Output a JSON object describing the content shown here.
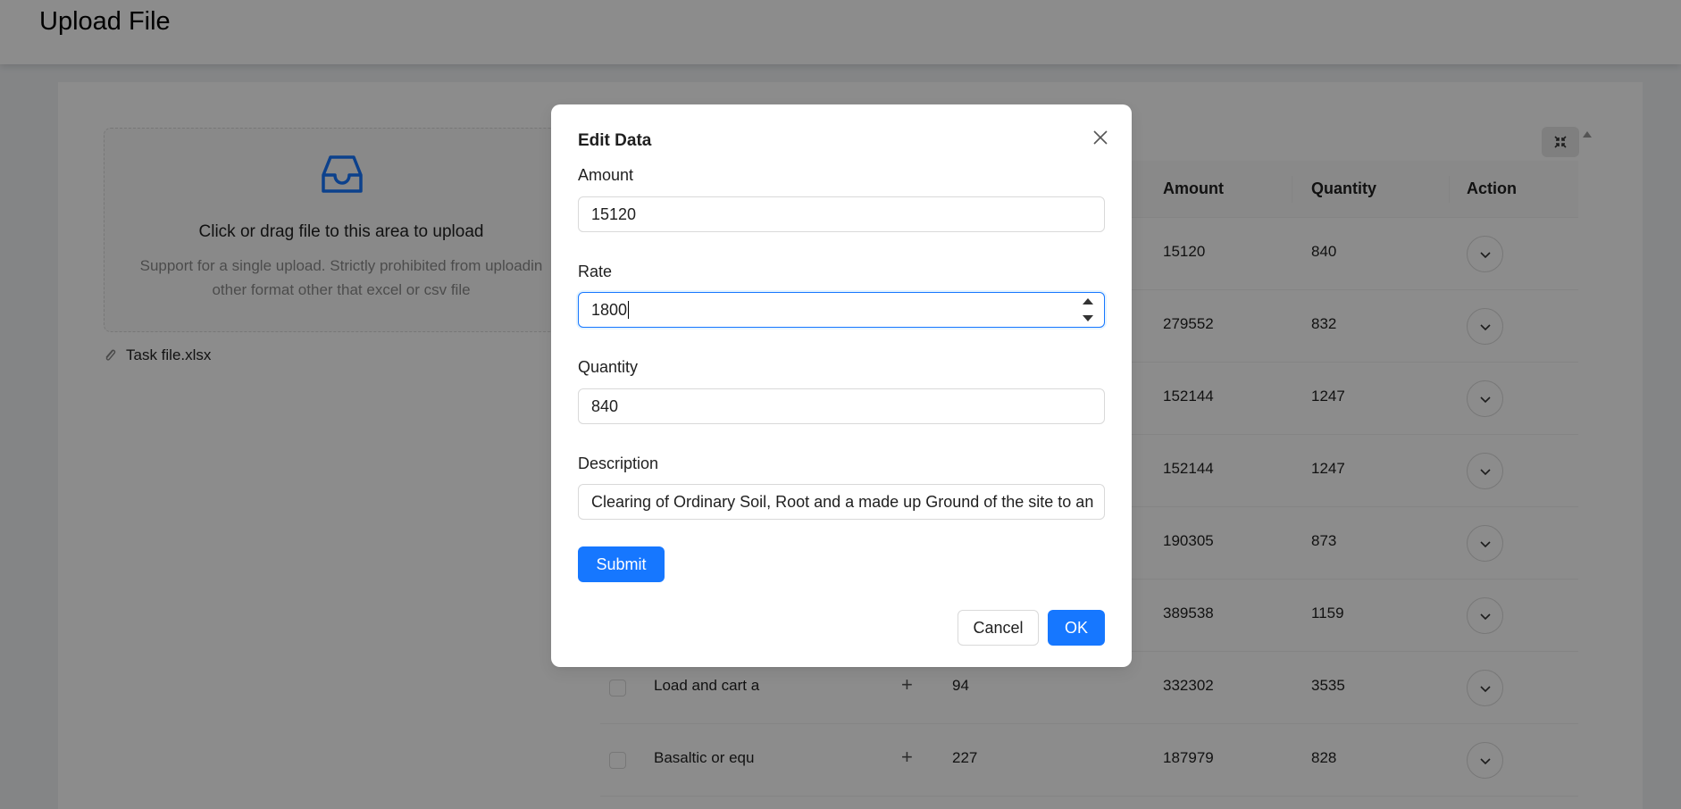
{
  "header": {
    "title": "Upload File"
  },
  "upload": {
    "main_text": "Click or drag file to this area to upload",
    "hint_line1": "Support for a single upload. Strictly prohibited from uploadin",
    "hint_line2": "other format other that excel or csv file",
    "file_name": "Task file.xlsx"
  },
  "table": {
    "columns": {
      "amount": "Amount",
      "quantity": "Quantity",
      "action": "Action"
    },
    "rows": [
      {
        "description": "",
        "rate": "",
        "amount": "15120",
        "quantity": "840"
      },
      {
        "description": "",
        "rate": "",
        "amount": "279552",
        "quantity": "832"
      },
      {
        "description": "",
        "rate": "",
        "amount": "152144",
        "quantity": "1247"
      },
      {
        "description": "",
        "rate": "",
        "amount": "152144",
        "quantity": "1247"
      },
      {
        "description": "",
        "rate": "",
        "amount": "190305",
        "quantity": "873"
      },
      {
        "description": "",
        "rate": "",
        "amount": "389538",
        "quantity": "1159"
      },
      {
        "description": "Load and cart a",
        "rate": "94",
        "amount": "332302",
        "quantity": "3535"
      },
      {
        "description": "Basaltic or equ",
        "rate": "227",
        "amount": "187979",
        "quantity": "828"
      }
    ],
    "expand_symbol": "+"
  },
  "modal": {
    "title": "Edit Data",
    "amount_label": "Amount",
    "amount_value": "15120",
    "rate_label": "Rate",
    "rate_value": "1800",
    "quantity_label": "Quantity",
    "quantity_value": "840",
    "description_label": "Description",
    "description_value": "Clearing of Ordinary Soil, Root and a made up Ground of the site to an",
    "submit_label": "Submit",
    "cancel_label": "Cancel",
    "ok_label": "OK"
  },
  "colors": {
    "primary": "#1677ff",
    "mask": "rgba(0,0,0,0.45)"
  },
  "icons": [
    "inbox-icon",
    "paperclip-icon",
    "chevron-down-icon",
    "fullscreen-exit-icon",
    "close-icon"
  ]
}
